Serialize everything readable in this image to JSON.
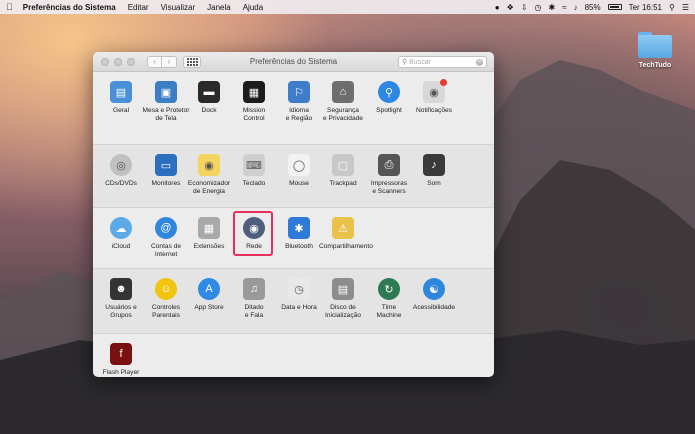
{
  "menubar": {
    "app": "Preferências do Sistema",
    "menus": [
      "Editar",
      "Visualizar",
      "Janela",
      "Ajuda"
    ],
    "battery": "85%",
    "clock": "Ter 16:51"
  },
  "desktop": {
    "folder_label": "TechTudo"
  },
  "window": {
    "title": "Preferências do Sistema",
    "search_placeholder": "Buscar"
  },
  "rows": [
    [
      {
        "name": "geral",
        "label": "Geral",
        "icon": "general-icon",
        "color": "#4a90d9"
      },
      {
        "name": "mesa-protetor",
        "label": "Mesa e Protetor\nde Tela",
        "icon": "desktop-icon",
        "color": "#3d7dc4"
      },
      {
        "name": "dock",
        "label": "Dock",
        "icon": "dock-icon",
        "color": "#2a2a2a"
      },
      {
        "name": "mission-control",
        "label": "Mission\nControl",
        "icon": "mission-control-icon",
        "color": "#1c1c1c"
      },
      {
        "name": "idioma-regiao",
        "label": "Idioma\ne Região",
        "icon": "globe-flag-icon",
        "color": "#3f7cc9"
      },
      {
        "name": "seguranca",
        "label": "Segurança\ne Privacidade",
        "icon": "house-lock-icon",
        "color": "#6e6e6e"
      },
      {
        "name": "spotlight",
        "label": "Spotlight",
        "icon": "spotlight-search-icon",
        "color": "#2e87e0"
      },
      {
        "name": "notificacoes",
        "label": "Notificações",
        "icon": "notifications-icon",
        "color": "#d8d8d8"
      }
    ],
    [
      {
        "name": "cds-dvds",
        "label": "CDs/DVDs",
        "icon": "disc-icon",
        "color": "#c0c0c0"
      },
      {
        "name": "monitores",
        "label": "Monitores",
        "icon": "monitor-icon",
        "color": "#2d6fbf"
      },
      {
        "name": "economizador",
        "label": "Economizador\nde Energia",
        "icon": "lightbulb-icon",
        "color": "#f4d35e"
      },
      {
        "name": "teclado",
        "label": "Teclado",
        "icon": "keyboard-icon",
        "color": "#cfcfcf"
      },
      {
        "name": "mouse",
        "label": "Mouse",
        "icon": "mouse-icon",
        "color": "#f2f2f2"
      },
      {
        "name": "trackpad",
        "label": "Trackpad",
        "icon": "trackpad-icon",
        "color": "#c8c8c8"
      },
      {
        "name": "impressoras",
        "label": "Impressoras\ne Scanners",
        "icon": "printer-icon",
        "color": "#555555"
      },
      {
        "name": "som",
        "label": "Som",
        "icon": "speaker-icon",
        "color": "#3a3a3a"
      }
    ],
    [
      {
        "name": "icloud",
        "label": "iCloud",
        "icon": "icloud-icon",
        "color": "#5aaae8"
      },
      {
        "name": "contas-internet",
        "label": "Contas de\nInternet",
        "icon": "at-sign-icon",
        "color": "#2f86dd"
      },
      {
        "name": "extensoes",
        "label": "Extensões",
        "icon": "puzzle-icon",
        "color": "#a9a9a9"
      },
      {
        "name": "rede",
        "label": "Rede",
        "icon": "network-globe-icon",
        "color": "#4f5e7c"
      },
      {
        "name": "bluetooth",
        "label": "Bluetooth",
        "icon": "bluetooth-icon",
        "color": "#2f7ad6"
      },
      {
        "name": "compartilhamento",
        "label": "Compartilhamento",
        "icon": "sharing-folder-icon",
        "color": "#e9c24a"
      }
    ],
    [
      {
        "name": "usuarios",
        "label": "Usuários e\nGrupos",
        "icon": "users-icon",
        "color": "#333333"
      },
      {
        "name": "controles-parentais",
        "label": "Controles\nParentais",
        "icon": "parental-controls-icon",
        "color": "#f1c40f"
      },
      {
        "name": "app-store",
        "label": "App Store",
        "icon": "app-store-icon",
        "color": "#2f8ae6"
      },
      {
        "name": "ditado-fala",
        "label": "Ditado\ne Fala",
        "icon": "microphone-icon",
        "color": "#9a9a9a"
      },
      {
        "name": "data-hora",
        "label": "Data e Hora",
        "icon": "clock-icon",
        "color": "#e8e8e8"
      },
      {
        "name": "disco-inicializacao",
        "label": "Disco de\nInicialização",
        "icon": "hard-disk-icon",
        "color": "#8d8d8d"
      },
      {
        "name": "time-machine",
        "label": "Time\nMachine",
        "icon": "time-machine-icon",
        "color": "#2d7a55"
      },
      {
        "name": "acessibilidade",
        "label": "Acessibilidade",
        "icon": "accessibility-icon",
        "color": "#2f86dd"
      }
    ],
    [
      {
        "name": "flash-player",
        "label": "Flash Player",
        "icon": "flash-icon",
        "color": "#7a1010"
      }
    ]
  ],
  "highlight_color": "#e8305f"
}
